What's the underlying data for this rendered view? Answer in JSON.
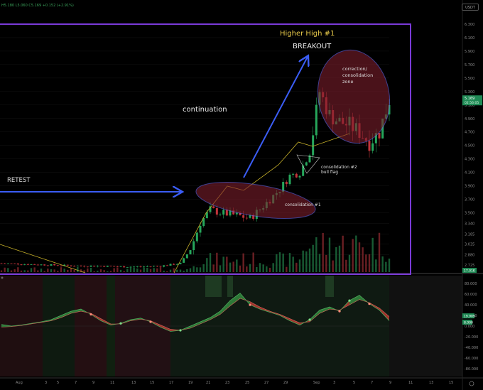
{
  "header": {
    "ohlc_text": "H5.180 L5.060 C5.169 +0.152 (+2.91%)",
    "currency": "USDT"
  },
  "chart_data": [
    {
      "type": "candlestick",
      "title": "",
      "price_axis_labels": [
        "6.300",
        "6.100",
        "5.900",
        "5.700",
        "5.500",
        "5.300",
        "5.100",
        "4.900",
        "4.700",
        "4.500",
        "4.300",
        "4.100",
        "3.900",
        "3.700",
        "3.500",
        "3.340",
        "3.185",
        "3.035",
        "2.880",
        "2.725"
      ],
      "price_range": [
        2.62,
        6.5
      ],
      "last_price_badge": "5.169",
      "last_price_badge_sub": "02:56:05",
      "volume_badge": "17.01K",
      "annotations": [
        "Higher High #1",
        "BREAKOUT",
        "correction/ consolidation zone",
        "continuation",
        "RETEST",
        "consolidation #2 bull flag",
        "consolidation #1"
      ],
      "series_approx": {
        "days": [
          0,
          2,
          4,
          6,
          8,
          10,
          12,
          14,
          16,
          18,
          19,
          20,
          21,
          22,
          23,
          24,
          25,
          26,
          27,
          28,
          29,
          30,
          31,
          32,
          33,
          34,
          35,
          36,
          37,
          38,
          39
        ],
        "close": [
          2.75,
          2.74,
          2.73,
          2.72,
          2.71,
          2.71,
          2.7,
          2.7,
          2.71,
          2.75,
          2.95,
          3.35,
          3.55,
          3.5,
          3.48,
          3.45,
          3.42,
          3.55,
          3.7,
          3.85,
          4.05,
          4.1,
          4.4,
          5.3,
          4.95,
          4.85,
          4.8,
          4.7,
          4.55,
          4.7,
          5.17
        ]
      }
    },
    {
      "type": "area",
      "title": "",
      "y_axis_labels": [
        "80.000",
        "60.000",
        "40.000",
        "20.000",
        "0.000",
        "-20.000",
        "-40.000",
        "-60.000",
        "-80.000"
      ],
      "y_range": [
        -95,
        95
      ],
      "badges": [
        "19.909",
        "8.000"
      ],
      "x_tick_labels": [
        "Aug",
        "3",
        "5",
        "7",
        "9",
        "11",
        "13",
        "15",
        "17",
        "19",
        "21",
        "23",
        "25",
        "27",
        "29",
        "Sep",
        "3",
        "5",
        "7",
        "9",
        "11",
        "13",
        "15"
      ],
      "series_approx": {
        "days": [
          0,
          1,
          2,
          3,
          4,
          5,
          6,
          7,
          8,
          9,
          10,
          11,
          12,
          13,
          14,
          15,
          16,
          17,
          18,
          19,
          20,
          21,
          22,
          23,
          24,
          25,
          26,
          27,
          28,
          29,
          30,
          31,
          32,
          33,
          34,
          35,
          36,
          37,
          38,
          39
        ],
        "fast": [
          3,
          0,
          2,
          5,
          8,
          12,
          20,
          28,
          32,
          22,
          10,
          2,
          5,
          12,
          15,
          8,
          -2,
          -10,
          -8,
          0,
          8,
          16,
          28,
          48,
          62,
          40,
          32,
          26,
          20,
          10,
          2,
          12,
          30,
          36,
          28,
          48,
          58,
          42,
          30,
          10
        ],
        "slow": [
          -2,
          -1,
          1,
          4,
          7,
          10,
          16,
          24,
          28,
          24,
          14,
          4,
          4,
          10,
          13,
          10,
          2,
          -6,
          -8,
          -4,
          4,
          12,
          22,
          38,
          52,
          46,
          36,
          28,
          22,
          14,
          6,
          8,
          24,
          32,
          30,
          40,
          50,
          44,
          34,
          18
        ]
      }
    }
  ]
}
